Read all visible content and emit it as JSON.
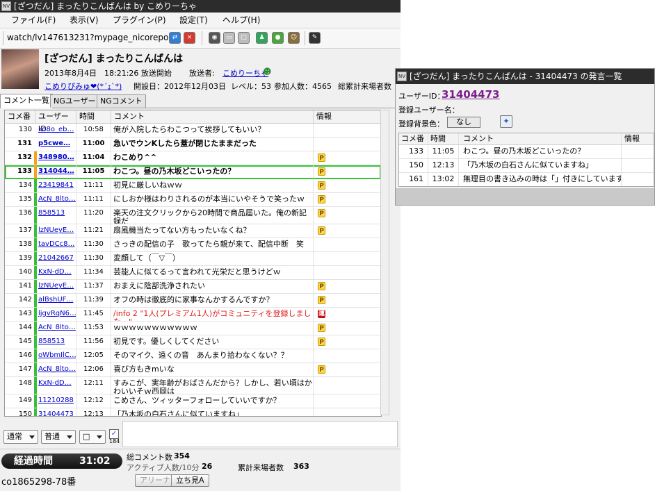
{
  "main_window": {
    "title": "[ざつだん] まったりこんばんは by こめりーちゃ",
    "icon_label": "NV",
    "menu": [
      "ファイル(F)",
      "表示(V)",
      "プラグイン(P)",
      "設定(T)",
      "ヘルプ(H)"
    ],
    "url": "watch/lv147613231?mypage_nicorepo"
  },
  "broadcast": {
    "title": "[ざつだん] まったりこんばんは",
    "start": "2013年8月4日　18:21:26 放送開始",
    "broadcaster_label": "放送者:",
    "broadcaster": "こめりーちゃ",
    "community": "こめりぴみゅ❤(*´ｪ`*)",
    "opened": "開設日：2012年12月03日",
    "level": "レベル：53",
    "participants": "参加人数：4565",
    "total_visitors_label": "総累計来場者数"
  },
  "tabs": [
    "コメント一覧",
    "NGユーザー",
    "NGコメント"
  ],
  "table": {
    "columns": [
      "コメ番",
      "ユーザーID",
      "時間",
      "コメント",
      "情報"
    ],
    "rows": [
      {
        "no": "130",
        "id": "ko8o_eb…",
        "time": "10:58",
        "comment": "俺が入院したらわこつって挨拶してもいい？",
        "info": "",
        "bar": "#ffffff",
        "bold": false,
        "selected": false,
        "red": false
      },
      {
        "no": "131",
        "id": "p5cwe…",
        "time": "11:00",
        "comment": "急いでウンKしたら蓋が閉じたままだった",
        "info": "",
        "bar": "#ffffff",
        "bold": true,
        "selected": false,
        "red": false
      },
      {
        "no": "132",
        "id": "348980…",
        "time": "11:04",
        "comment": "わこめり^^",
        "info": "P",
        "bar": "#f7a21b",
        "bold": true,
        "selected": false,
        "red": false
      },
      {
        "no": "133",
        "id": "314044…",
        "time": "11:05",
        "comment": "わこつ。昼の乃木坂どこいったの？",
        "info": "P",
        "bar": "#f7a21b",
        "bold": true,
        "selected": true,
        "red": false
      },
      {
        "no": "134",
        "id": "23419841",
        "time": "11:11",
        "comment": "初見に厳しいねｗｗ",
        "info": "P",
        "bar": "#3bbf3b",
        "bold": false,
        "selected": false,
        "red": false
      },
      {
        "no": "135",
        "id": "AcN_8lto…",
        "time": "11:11",
        "comment": "にしおか様はわりされるのが本当にいやそうで笑ったｗ",
        "info": "P",
        "bar": "#3bbf3b",
        "bold": false,
        "selected": false,
        "red": false
      },
      {
        "no": "136",
        "id": "858513",
        "time": "11:20",
        "comment": "楽天の注文クリックから20時間で商品届いた。俺の新記録だ",
        "info": "P",
        "bar": "#3bbf3b",
        "bold": false,
        "selected": false,
        "red": false
      },
      {
        "no": "137",
        "id": "lzNUeyE…",
        "time": "11:21",
        "comment": "扇風機当たってない方もったいなくね？",
        "info": "P",
        "bar": "#3bbf3b",
        "bold": false,
        "selected": false,
        "red": false
      },
      {
        "no": "138",
        "id": "tavDCc8…",
        "time": "11:30",
        "comment": "さっきの配信の子　歌ってたら親が来て、配信中断　笑",
        "info": "",
        "bar": "#3bbf3b",
        "bold": false,
        "selected": false,
        "red": false
      },
      {
        "no": "139",
        "id": "21042667",
        "time": "11:30",
        "comment": "変顔して（￣▽￣）",
        "info": "",
        "bar": "#3bbf3b",
        "bold": false,
        "selected": false,
        "red": false
      },
      {
        "no": "140",
        "id": "KxN-dD…",
        "time": "11:34",
        "comment": "芸能人に似てるって言われて光栄だと思うけどｗ",
        "info": "",
        "bar": "#3bbf3b",
        "bold": false,
        "selected": false,
        "red": false
      },
      {
        "no": "141",
        "id": "lzNUeyE…",
        "time": "11:37",
        "comment": "おまえに陰部洗浄されたい",
        "info": "P",
        "bar": "#3bbf3b",
        "bold": false,
        "selected": false,
        "red": false
      },
      {
        "no": "142",
        "id": "alBshUF…",
        "time": "11:39",
        "comment": "オフの時は徹底的に家事なんかするんですか？",
        "info": "P",
        "bar": "#3bbf3b",
        "bold": false,
        "selected": false,
        "red": false
      },
      {
        "no": "143",
        "id": "ljgvRqN6…",
        "time": "11:45",
        "comment": "/info 2 \"1人(プレミアム1人)がコミュニティを登録しました。\"",
        "info": "運",
        "bar": "#3bbf3b",
        "bold": false,
        "selected": false,
        "red": true
      },
      {
        "no": "144",
        "id": "AcN_8lto…",
        "time": "11:53",
        "comment": "ｗｗｗｗｗｗｗｗｗｗｗ",
        "info": "P",
        "bar": "#3bbf3b",
        "bold": false,
        "selected": false,
        "red": false
      },
      {
        "no": "145",
        "id": "858513",
        "time": "11:56",
        "comment": "初見です。優しくしてください",
        "info": "P",
        "bar": "#3bbf3b",
        "bold": false,
        "selected": false,
        "red": false
      },
      {
        "no": "146",
        "id": "oWbmIlC…",
        "time": "12:05",
        "comment": "そのマイク、遠くの音　あんまり拾わなくない？？",
        "info": "",
        "bar": "#3bbf3b",
        "bold": false,
        "selected": false,
        "red": false
      },
      {
        "no": "147",
        "id": "AcN_8lto…",
        "time": "12:06",
        "comment": "喜び方もきmいな",
        "info": "P",
        "bar": "#3bbf3b",
        "bold": false,
        "selected": false,
        "red": false
      },
      {
        "no": "148",
        "id": "KxN-dD…",
        "time": "12:11",
        "comment": "すみこが、実年齢がおばさんだから？しかし、若い頃はかわいいそｗ西岡は",
        "info": "",
        "bar": "#3bbf3b",
        "bold": false,
        "selected": false,
        "red": false
      },
      {
        "no": "149",
        "id": "11210288",
        "time": "12:12",
        "comment": "こめさん、ツィッターフォローしていいですか？",
        "info": "",
        "bar": "#3bbf3b",
        "bold": false,
        "selected": false,
        "red": false
      },
      {
        "no": "150",
        "id": "31404473",
        "time": "12:13",
        "comment": "「乃木坂の白石さんに似ていますね」",
        "info": "",
        "bar": "#3bbf3b",
        "bold": false,
        "selected": false,
        "red": false
      }
    ]
  },
  "controls": {
    "position": "通常",
    "size": "普通",
    "color": "□",
    "checkbox_label": "184"
  },
  "status": {
    "elapsed_label": "経過時間",
    "elapsed_value": "31:02",
    "total_comments_label": "総コメント数",
    "total_comments": "354",
    "active_label": "アクティブ人数/10分",
    "active": "26",
    "cumulative_label": "累計来場者数",
    "cumulative": "363",
    "community_id": "co1865298-78番",
    "arena_button": "アリーナ",
    "standing_button": "立ち見A"
  },
  "sub_window": {
    "title": "[ざつだん] まったりこんばんは - 31404473 の発言一覧",
    "icon_label": "NV",
    "user_id_label": "ユーザーID：",
    "user_id": "31404473",
    "user_name_label": "登録ユーザー名：",
    "bg_label": "登録背景色：",
    "bg_value": "なし",
    "columns": [
      "コメ番",
      "時間",
      "コメント",
      "情報"
    ],
    "rows": [
      {
        "no": "133",
        "time": "11:05",
        "comment": "わこつ。昼の乃木坂どこいったの？"
      },
      {
        "no": "150",
        "time": "12:13",
        "comment": "「乃木坂の白石さんに似ていますね」"
      },
      {
        "no": "161",
        "time": "13:02",
        "comment": "無理目の書き込みの時は「」付きにしています"
      }
    ]
  }
}
